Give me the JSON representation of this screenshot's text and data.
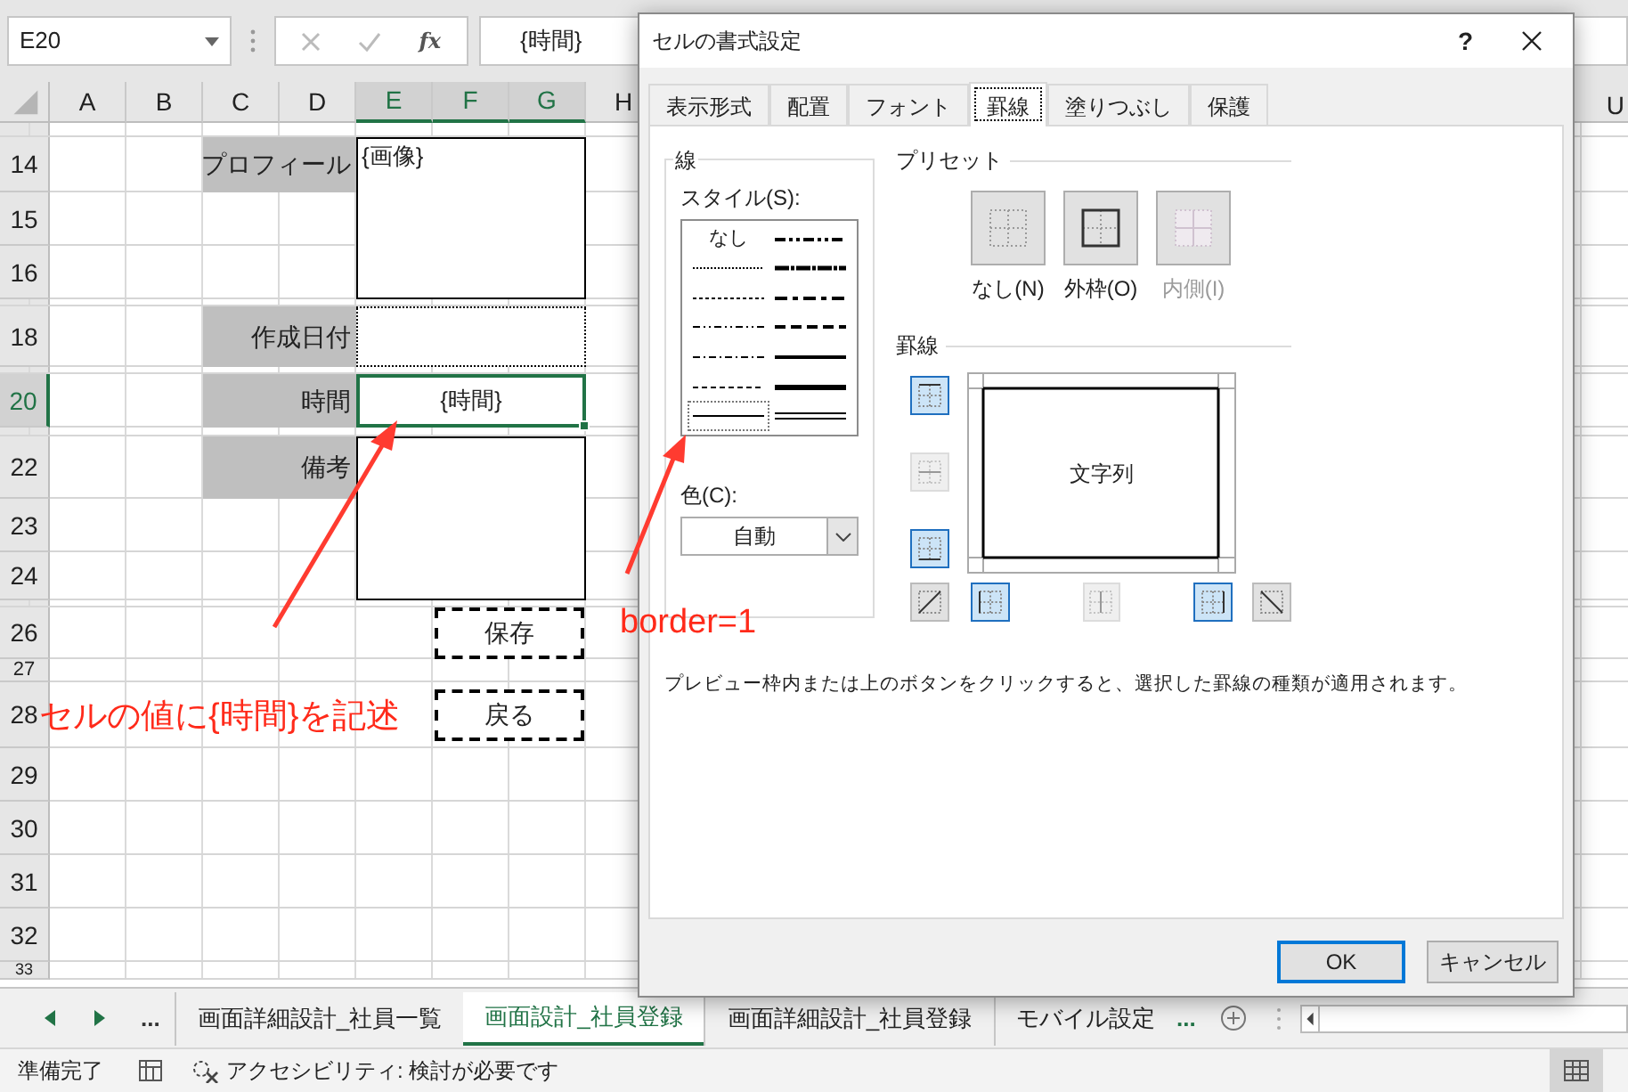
{
  "name_box": "E20",
  "formula_bar": {
    "function_label": "fx",
    "value": "{時間}"
  },
  "columns": [
    {
      "label": "A",
      "selected": false
    },
    {
      "label": "B",
      "selected": false
    },
    {
      "label": "C",
      "selected": false
    },
    {
      "label": "D",
      "selected": false
    },
    {
      "label": "E",
      "selected": true
    },
    {
      "label": "F",
      "selected": true
    },
    {
      "label": "G",
      "selected": true
    },
    {
      "label": "H",
      "selected": false
    }
  ],
  "partial_column": "U",
  "rows": [
    {
      "label": "14",
      "selected": false
    },
    {
      "label": "15",
      "selected": false
    },
    {
      "label": "16",
      "selected": false
    },
    {
      "label": "18",
      "selected": false
    },
    {
      "label": "20",
      "selected": true
    },
    {
      "label": "22",
      "selected": false
    },
    {
      "label": "23",
      "selected": false
    },
    {
      "label": "24",
      "selected": false
    },
    {
      "label": "26",
      "selected": false
    },
    {
      "label": "27",
      "selected": false
    },
    {
      "label": "28",
      "selected": false
    },
    {
      "label": "29",
      "selected": false
    },
    {
      "label": "30",
      "selected": false
    },
    {
      "label": "31",
      "selected": false
    },
    {
      "label": "32",
      "selected": false
    },
    {
      "label": "33",
      "selected": false
    }
  ],
  "form": [
    {
      "kind": "image",
      "label": "プロフィール",
      "value": "{画像}",
      "selected": false
    },
    {
      "kind": "date",
      "label": "作成日付",
      "selected": false
    },
    {
      "kind": "time",
      "label": "時間",
      "value": "{時間}",
      "selected": true
    },
    {
      "kind": "memo",
      "label": "備考",
      "selected": false
    }
  ],
  "sheet_buttons": [
    "保存",
    "戻る"
  ],
  "annotations": [
    {
      "kind": "cell",
      "text": "セルの値に{時間}を記述"
    },
    {
      "kind": "style",
      "text": "border=1"
    }
  ],
  "dialog": {
    "title": "セルの書式設定",
    "help": "?",
    "tabs": [
      {
        "label": "表示形式",
        "selected": false
      },
      {
        "label": "配置",
        "selected": false
      },
      {
        "label": "フォント",
        "selected": false
      },
      {
        "label": "罫線",
        "selected": true
      },
      {
        "label": "塗りつぶし",
        "selected": false
      },
      {
        "label": "保護",
        "selected": false
      }
    ],
    "line": {
      "title": "線",
      "style_label": "スタイル(S):",
      "styles": [
        {
          "kind": "none",
          "label": "なし",
          "selected": false
        },
        {
          "kind": "hair",
          "selected": false
        },
        {
          "kind": "dotted",
          "selected": false
        },
        {
          "kind": "dashdotdot",
          "selected": false
        },
        {
          "kind": "dashdot",
          "selected": false
        },
        {
          "kind": "dashed",
          "selected": false
        },
        {
          "kind": "thin",
          "selected": true
        },
        {
          "kind": "medium_dashdotdot",
          "selected": false
        },
        {
          "kind": "slant_dashdot",
          "selected": false
        },
        {
          "kind": "medium_dashdot",
          "selected": false
        },
        {
          "kind": "medium_dashed",
          "selected": false
        },
        {
          "kind": "medium",
          "selected": false
        },
        {
          "kind": "thick",
          "selected": false
        },
        {
          "kind": "double",
          "selected": false
        }
      ],
      "color_label": "色(C):",
      "color_value": "自動"
    },
    "presets": {
      "title": "プリセット",
      "items": [
        {
          "kind": "none",
          "label": "なし(N)",
          "disabled": false
        },
        {
          "kind": "outline",
          "label": "外枠(O)",
          "disabled": false
        },
        {
          "kind": "inside",
          "label": "内側(I)",
          "disabled": true
        }
      ]
    },
    "border": {
      "title": "罫線",
      "preview_text": "文字列",
      "buttons": [
        {
          "kind": "top",
          "on": true,
          "disabled": false
        },
        {
          "kind": "middle_h",
          "on": false,
          "disabled": true
        },
        {
          "kind": "bottom",
          "on": true,
          "disabled": false
        },
        {
          "kind": "diag_up",
          "on": false,
          "disabled": false
        },
        {
          "kind": "left",
          "on": true,
          "disabled": false
        },
        {
          "kind": "middle_v",
          "on": false,
          "disabled": true
        },
        {
          "kind": "right",
          "on": true,
          "disabled": false
        },
        {
          "kind": "diag_down",
          "on": false,
          "disabled": false
        }
      ]
    },
    "hint": "プレビュー枠内または上のボタンをクリックすると、選択した罫線の種類が適用されます。",
    "buttons": [
      {
        "label": "OK",
        "default": true
      },
      {
        "label": "キャンセル",
        "default": false
      }
    ]
  },
  "sheet_tabs": {
    "more_left": "...",
    "tabs": [
      {
        "label": "画面詳細設計_社員一覧",
        "selected": false
      },
      {
        "label": "画面設計_社員登録",
        "selected": true
      },
      {
        "label": "画面詳細設計_社員登録",
        "selected": false
      },
      {
        "label": "モバイル設定",
        "selected": false
      }
    ],
    "more_right": "..."
  },
  "status_bar": {
    "mode": "準備完了",
    "accessibility": "アクセシビリティ: 検討が必要です"
  }
}
